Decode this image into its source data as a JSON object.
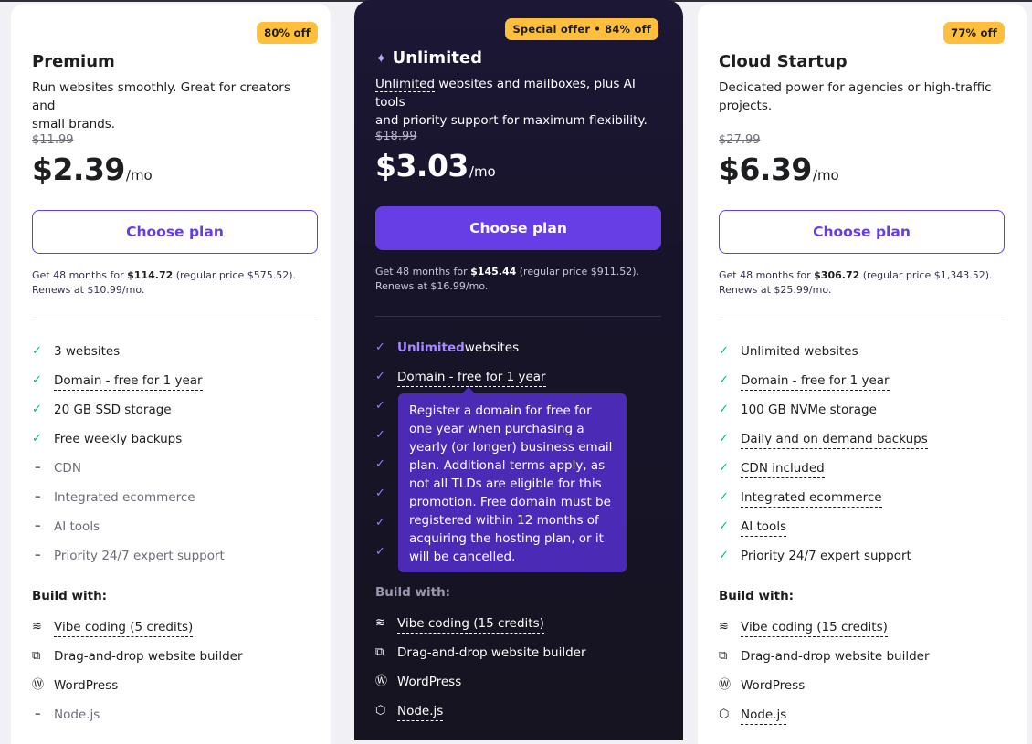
{
  "plans": [
    {
      "badge": "80% off",
      "title": "Premium",
      "desc_lines": [
        "Run websites smoothly. Great for creators and",
        "small brands."
      ],
      "old_price": "$11.99",
      "price": "$2.39",
      "per": "/mo",
      "button": "Choose plan",
      "terms_pre": "Get 48 months for ",
      "terms_amount": "$114.72",
      "terms_post": " (regular price $575.52).",
      "terms_renew": "Renews at $10.99/mo.",
      "features": [
        {
          "text": "3 websites",
          "included": true
        },
        {
          "text": "Domain - free for 1 year",
          "included": true,
          "dotted": true
        },
        {
          "text": "20 GB SSD storage",
          "included": true
        },
        {
          "text": "Free weekly backups",
          "included": true
        },
        {
          "text": "CDN",
          "included": false
        },
        {
          "text": "Integrated ecommerce",
          "included": false
        },
        {
          "text": "AI tools",
          "included": false
        },
        {
          "text": "Priority 24/7 expert support",
          "included": false
        }
      ],
      "build_title": "Build with:",
      "build": [
        {
          "icon": "vibe-coding-icon",
          "text": "Vibe coding (5 credits)",
          "dotted": true,
          "included": true
        },
        {
          "icon": "website-builder-icon",
          "text": "Drag-and-drop website builder",
          "included": true
        },
        {
          "icon": "wordpress-icon",
          "text": "WordPress",
          "included": true
        },
        {
          "icon": "dash-icon",
          "text": "Node.js",
          "included": false
        }
      ]
    },
    {
      "badge": "Special offer • 84% off",
      "title": "Unlimited",
      "desc_lines": [
        "Unlimited",
        " websites and mailboxes, plus AI tools",
        "and priority support for maximum flexibility."
      ],
      "old_price": "$18.99",
      "price": "$3.03",
      "per": "/mo",
      "button": "Choose plan",
      "terms_pre": "Get 48 months for ",
      "terms_amount": "$145.44",
      "terms_post": " (regular price $911.52).",
      "terms_renew": "Renews at $16.99/mo.",
      "features": [
        {
          "highlight": "Unlimited",
          "text": " websites",
          "included": true
        },
        {
          "text": "Domain - free for 1 year",
          "included": true,
          "dotted": true
        },
        {
          "text": "",
          "included": true
        },
        {
          "text": "",
          "included": true
        },
        {
          "text": "",
          "included": true
        },
        {
          "text": "",
          "included": true
        },
        {
          "text": "",
          "included": true
        },
        {
          "text": "",
          "included": true
        }
      ],
      "build_title": "Build with:",
      "build": [
        {
          "icon": "vibe-coding-icon",
          "text": "Vibe coding (15 credits)",
          "dotted": true,
          "included": true
        },
        {
          "icon": "website-builder-icon",
          "text": "Drag-and-drop website builder",
          "included": true
        },
        {
          "icon": "wordpress-icon",
          "text": "WordPress",
          "included": true
        },
        {
          "icon": "nodejs-icon",
          "text": "Node.js",
          "dotted": true,
          "included": true
        }
      ]
    },
    {
      "badge": "77% off",
      "title": "Cloud Startup",
      "desc_lines": [
        "Dedicated power for agencies or high-traffic",
        "projects."
      ],
      "old_price": "$27.99",
      "price": "$6.39",
      "per": "/mo",
      "button": "Choose plan",
      "terms_pre": "Get 48 months for ",
      "terms_amount": "$306.72",
      "terms_post": " (regular price $1,343.52).",
      "terms_renew": "Renews at $25.99/mo.",
      "features": [
        {
          "text": "Unlimited websites",
          "included": true
        },
        {
          "text": "Domain - free for 1 year",
          "included": true,
          "dotted": true
        },
        {
          "text": "100 GB NVMe storage",
          "included": true
        },
        {
          "text": "Daily and on demand backups",
          "included": true,
          "dotted": true
        },
        {
          "text": "CDN included",
          "included": true,
          "dotted": true
        },
        {
          "text": "Integrated ecommerce",
          "included": true,
          "dotted": true
        },
        {
          "text": "AI tools",
          "included": true,
          "dotted": true
        },
        {
          "text": "Priority 24/7 expert support",
          "included": true
        }
      ],
      "build_title": "Build with:",
      "build": [
        {
          "icon": "vibe-coding-icon",
          "text": "Vibe coding (15 credits)",
          "dotted": true,
          "included": true
        },
        {
          "icon": "website-builder-icon",
          "text": "Drag-and-drop website builder",
          "included": true
        },
        {
          "icon": "wordpress-icon",
          "text": "WordPress",
          "included": true
        },
        {
          "icon": "nodejs-icon",
          "text": "Node.js",
          "dotted": true,
          "included": true
        }
      ]
    }
  ],
  "tooltip": {
    "text": "Register a domain for free for one year when purchasing a yearly (or longer) business email plan. Additional terms apply, as not all TLDs are eligible for this promotion. Free domain must be registered within 12 months of acquiring the hosting plan, or it will be cancelled."
  },
  "colors": {
    "accent": "#673de6",
    "badge": "#ffbf3c",
    "check": "#00b090",
    "dark_card": "#17142a",
    "tooltip_bg": "#4b2bb5"
  }
}
